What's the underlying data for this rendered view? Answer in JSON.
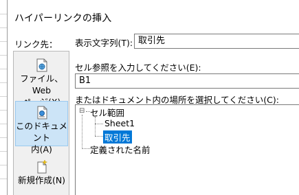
{
  "dialog": {
    "title": "ハイパーリンクの挿入"
  },
  "link_to": {
    "label": "リンク先：",
    "items": [
      {
        "line1": "ファイル、Web",
        "line2": "ページ(X)",
        "icon": "web-page-icon",
        "selected": false
      },
      {
        "line1": "このドキュメント",
        "line2": "内(A)",
        "icon": "document-icon",
        "selected": true
      },
      {
        "line1": "新規作成(N)",
        "line2": "",
        "icon": "new-document-icon",
        "selected": false
      }
    ]
  },
  "display_text": {
    "label": "表示文字列(T):",
    "value": "取引先"
  },
  "cell_ref": {
    "label": "セル参照を入力してください(E):",
    "value": "B1"
  },
  "place": {
    "label": "またはドキュメント内の場所を選択してください(C):",
    "tree": {
      "root": "セル範囲",
      "toggle": "⊟",
      "children": [
        "Sheet1",
        "取引先"
      ],
      "selected": "取引先",
      "defined_names": "定義された名前"
    }
  },
  "colors": {
    "selection": "#0078d7",
    "linkbar_selected": "#cce4f7"
  }
}
